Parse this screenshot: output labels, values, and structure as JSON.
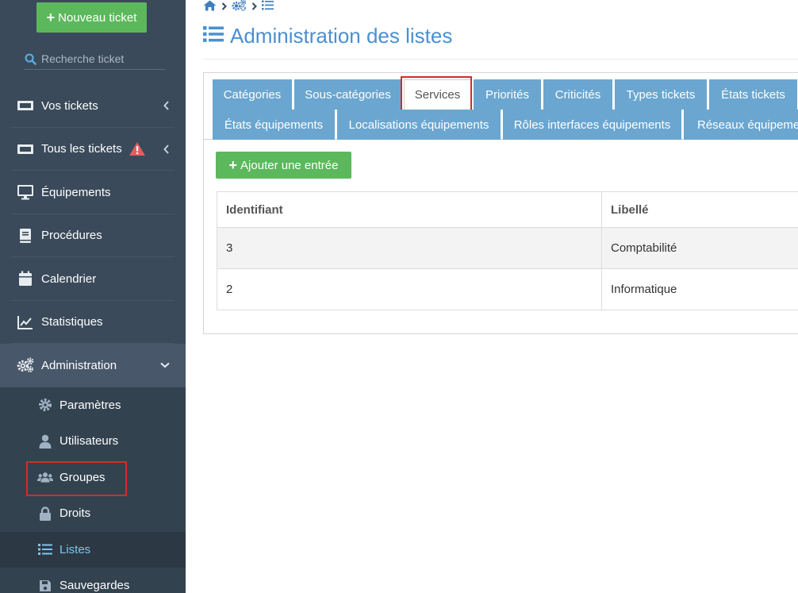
{
  "sidebar": {
    "new_ticket_label": "Nouveau ticket",
    "search_placeholder": "Recherche ticket",
    "items": [
      {
        "label": "Vos tickets",
        "icon": "ticket-icon"
      },
      {
        "label": "Tous les tickets",
        "icon": "ticket-icon"
      },
      {
        "label": "Équipements",
        "icon": "monitor-icon"
      },
      {
        "label": "Procédures",
        "icon": "book-icon"
      },
      {
        "label": "Calendrier",
        "icon": "calendar-icon"
      },
      {
        "label": "Statistiques",
        "icon": "chart-icon"
      },
      {
        "label": "Administration",
        "icon": "gears-icon"
      }
    ],
    "submenu": [
      {
        "label": "Paramètres",
        "icon": "gear-icon"
      },
      {
        "label": "Utilisateurs",
        "icon": "user-icon"
      },
      {
        "label": "Groupes",
        "icon": "users-icon"
      },
      {
        "label": "Droits",
        "icon": "lock-icon"
      },
      {
        "label": "Listes",
        "icon": "list-icon"
      },
      {
        "label": "Sauvegardes",
        "icon": "save-icon"
      }
    ]
  },
  "page": {
    "title": "Administration des listes"
  },
  "tabs": {
    "row1": [
      "Catégories",
      "Sous-catégories",
      "Services",
      "Priorités",
      "Criticités",
      "Types tickets",
      "États tickets"
    ],
    "row2": [
      "États équipements",
      "Localisations équipements",
      "Rôles interfaces équipements",
      "Réseaux équipements"
    ],
    "active": "Services"
  },
  "content": {
    "add_label": "Ajouter une entrée",
    "columns": [
      "Identifiant",
      "Libellé"
    ],
    "rows": [
      {
        "id": "3",
        "label": "Comptabilité"
      },
      {
        "id": "2",
        "label": "Informatique"
      }
    ]
  },
  "colors": {
    "sidebar_bg": "#3a4a5a",
    "accent_green": "#5cb85c",
    "tab_blue": "#6aa6d0",
    "title_blue": "#4a90d0",
    "highlight_red": "#d62a2a"
  }
}
